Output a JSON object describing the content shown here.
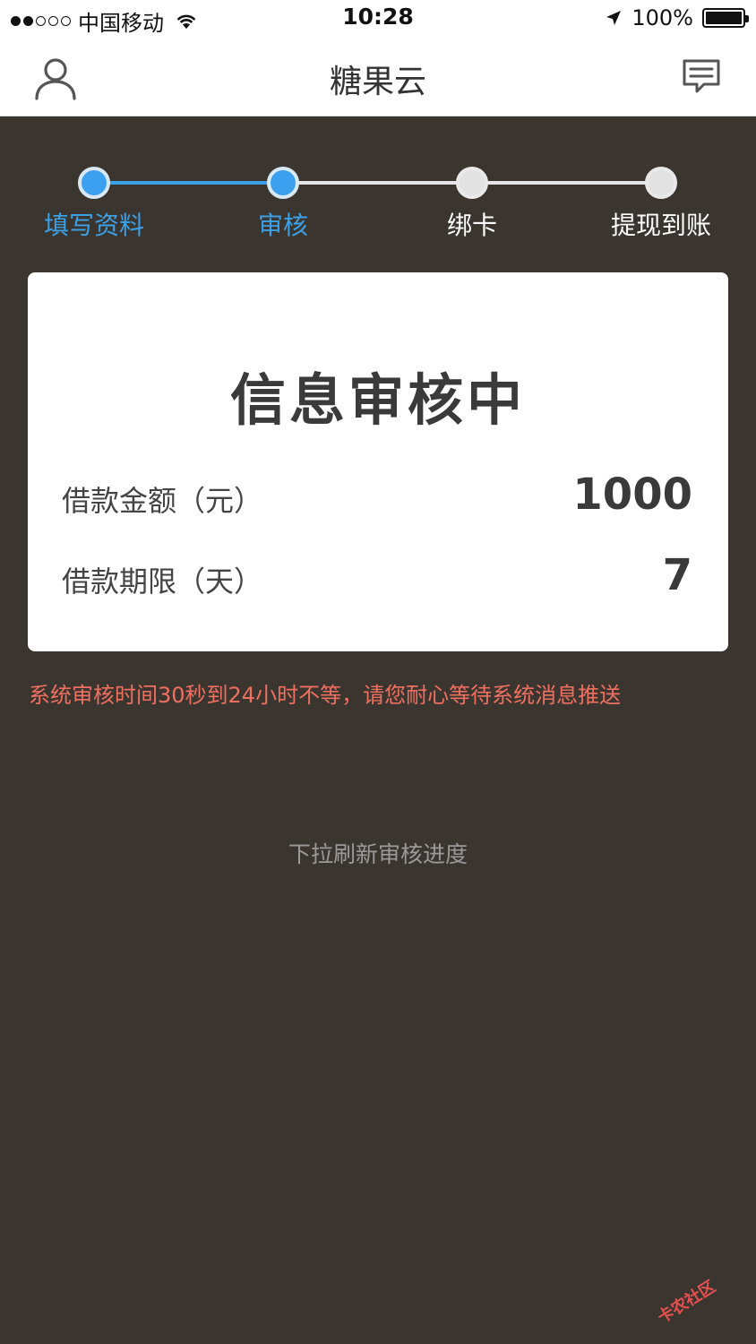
{
  "status_bar": {
    "carrier": "中国移动",
    "time": "10:28",
    "battery": "100%"
  },
  "nav": {
    "title": "糖果云",
    "left_icon": "user-icon",
    "right_icon": "message-icon"
  },
  "steps": [
    {
      "label": "填写资料",
      "active": true
    },
    {
      "label": "审核",
      "active": true
    },
    {
      "label": "绑卡",
      "active": false
    },
    {
      "label": "提现到账",
      "active": false
    }
  ],
  "card": {
    "title": "信息审核中",
    "amount_label": "借款金额（元）",
    "amount_value": "1000",
    "term_label": "借款期限（天）",
    "term_value": "7"
  },
  "notice": "系统审核时间30秒到24小时不等，请您耐心等待系统消息推送",
  "pull_hint": "下拉刷新审核进度",
  "watermark": "卡农社区",
  "colors": {
    "accent": "#3ca0e6",
    "background": "#3b3530",
    "notice": "#f07060"
  }
}
